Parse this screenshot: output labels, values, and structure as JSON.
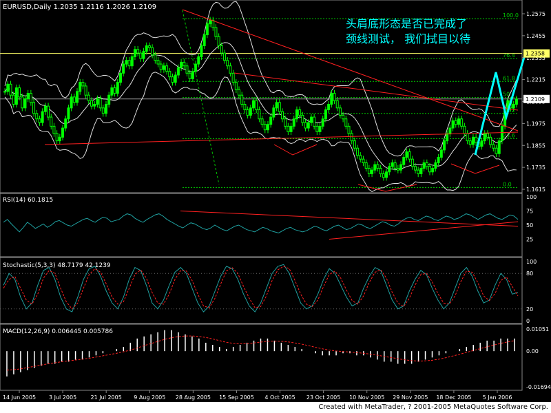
{
  "chart_data": [
    {
      "type": "candlestick",
      "title": "EURUSD,Daily",
      "ohlc_label": "1.2035 1.2116 1.2026 1.2109",
      "ylim": [
        1.1615,
        1.2575
      ],
      "y_ticks": [
        1.2575,
        1.2455,
        1.2335,
        1.2215,
        1.2095,
        1.1975,
        1.1855,
        1.1735,
        1.1615
      ],
      "current_price_label": "1.2109",
      "highlight_level": 1.2358,
      "highlight_level_label": "1.2358",
      "fib_levels": [
        {
          "label": "100.0",
          "value": 1.2548
        },
        {
          "label": "76.4",
          "value": 1.233
        },
        {
          "label": "61.8",
          "value": 1.2205
        },
        {
          "label": "50",
          "value": 1.2117
        },
        {
          "label": "38.2",
          "value": 1.203
        },
        {
          "label": "23.6",
          "value": 1.1892
        },
        {
          "label": "0.0",
          "value": 1.1625
        }
      ],
      "annotation": [
        "头肩底形态是否已完成了",
        "颈线测试， 我们拭目以待"
      ],
      "close_series": [
        1.215,
        1.219,
        1.213,
        1.208,
        1.217,
        1.212,
        1.206,
        1.211,
        1.214,
        1.209,
        1.203,
        1.2,
        1.198,
        1.204,
        1.207,
        1.201,
        1.196,
        1.192,
        1.188,
        1.19,
        1.195,
        1.2,
        1.206,
        1.212,
        1.209,
        1.215,
        1.22,
        1.218,
        1.213,
        1.21,
        1.207,
        1.208,
        1.211,
        1.206,
        1.203,
        1.208,
        1.213,
        1.217,
        1.214,
        1.22,
        1.225,
        1.23,
        1.232,
        1.229,
        1.234,
        1.238,
        1.236,
        1.233,
        1.237,
        1.24,
        1.239,
        1.235,
        1.232,
        1.23,
        1.227,
        1.229,
        1.226,
        1.223,
        1.22,
        1.224,
        1.228,
        1.231,
        1.229,
        1.225,
        1.222,
        1.226,
        1.23,
        1.234,
        1.24,
        1.246,
        1.252,
        1.254,
        1.25,
        1.245,
        1.24,
        1.236,
        1.232,
        1.229,
        1.225,
        1.22,
        1.216,
        1.213,
        1.208,
        1.205,
        1.202,
        1.206,
        1.21,
        1.205,
        1.2,
        1.197,
        1.194,
        1.197,
        1.201,
        1.206,
        1.209,
        1.204,
        1.2,
        1.196,
        1.193,
        1.196,
        1.2,
        1.205,
        1.202,
        1.198,
        1.195,
        1.198,
        1.201,
        1.196,
        1.193,
        1.196,
        1.2,
        1.205,
        1.208,
        1.214,
        1.21,
        1.206,
        1.202,
        1.2,
        1.196,
        1.192,
        1.188,
        1.184,
        1.18,
        1.178,
        1.176,
        1.173,
        1.17,
        1.172,
        1.175,
        1.173,
        1.17,
        1.168,
        1.171,
        1.174,
        1.176,
        1.173,
        1.172,
        1.175,
        1.179,
        1.182,
        1.178,
        1.174,
        1.172,
        1.17,
        1.173,
        1.176,
        1.174,
        1.171,
        1.173,
        1.176,
        1.179,
        1.183,
        1.188,
        1.192,
        1.195,
        1.199,
        1.197,
        1.2,
        1.196,
        1.192,
        1.188,
        1.186,
        1.19,
        1.187,
        1.185,
        1.188,
        1.192,
        1.19,
        1.186,
        1.184,
        1.181,
        1.188,
        1.196,
        1.204,
        1.21,
        1.206,
        1.208,
        1.2109
      ]
    },
    {
      "type": "line",
      "title": "RSI(14) 60.1815",
      "ylim": [
        0,
        100
      ],
      "y_ticks": [
        100,
        75,
        50,
        25
      ],
      "values": [
        55,
        60,
        52,
        45,
        38,
        46,
        55,
        50,
        44,
        48,
        52,
        46,
        50,
        56,
        58,
        54,
        50,
        48,
        52,
        56,
        60,
        62,
        58,
        55,
        60,
        64,
        62,
        56,
        58,
        60,
        66,
        70,
        68,
        62,
        58,
        55,
        60,
        64,
        68,
        70,
        66,
        60,
        56,
        52,
        48,
        45,
        50,
        54,
        52,
        48,
        44,
        42,
        45,
        50,
        46,
        42,
        40,
        44,
        48,
        50,
        46,
        42,
        40,
        38,
        42,
        46,
        44,
        40,
        38,
        36,
        40,
        44,
        46,
        42,
        40,
        38,
        40,
        44,
        48,
        46,
        42,
        40,
        44,
        48,
        50,
        46,
        42,
        44,
        48,
        52,
        50,
        46,
        44,
        48,
        52,
        56,
        54,
        50,
        48,
        52,
        58,
        62,
        64,
        60,
        58,
        62,
        66,
        64,
        60,
        58,
        62,
        66,
        64,
        60,
        62,
        66,
        70,
        68,
        64,
        60,
        64,
        68,
        70,
        66,
        62,
        60,
        64,
        68,
        66,
        60
      ]
    },
    {
      "type": "line",
      "title": "Stochastic(5,3,3) 48.7179 42.1239",
      "ylim": [
        0,
        100
      ],
      "y_ticks": [
        100,
        80,
        20,
        0
      ],
      "series": [
        {
          "values": [
            60,
            80,
            70,
            40,
            20,
            30,
            60,
            85,
            90,
            70,
            40,
            20,
            15,
            40,
            70,
            88,
            92,
            75,
            50,
            30,
            20,
            40,
            70,
            90,
            85,
            60,
            30,
            20,
            35,
            60,
            82,
            90,
            80,
            55,
            30,
            15,
            25,
            50,
            75,
            92,
            88,
            70,
            45,
            25,
            15,
            30,
            55,
            80,
            92,
            95,
            80,
            55,
            30,
            20,
            25,
            45,
            70,
            88,
            80,
            60,
            40,
            25,
            30,
            55,
            75,
            90,
            85,
            60,
            35,
            20,
            25,
            50,
            70,
            85,
            78,
            55,
            35,
            20,
            30,
            55,
            80,
            90,
            75,
            50,
            30,
            35,
            60,
            80,
            70,
            45,
            48
          ]
        },
        {
          "values": [
            55,
            70,
            75,
            55,
            35,
            28,
            45,
            72,
            85,
            80,
            55,
            32,
            20,
            30,
            55,
            78,
            88,
            82,
            62,
            40,
            28,
            32,
            55,
            78,
            86,
            72,
            48,
            30,
            28,
            45,
            70,
            85,
            84,
            68,
            45,
            25,
            22,
            38,
            62,
            84,
            90,
            80,
            58,
            38,
            22,
            24,
            42,
            68,
            86,
            92,
            88,
            68,
            45,
            28,
            24,
            35,
            58,
            78,
            84,
            72,
            52,
            34,
            28,
            42,
            65,
            82,
            86,
            72,
            48,
            30,
            24,
            38,
            60,
            78,
            80,
            66,
            46,
            30,
            28,
            42,
            66,
            84,
            82,
            64,
            42,
            34,
            46,
            68,
            74,
            58,
            42
          ]
        }
      ]
    },
    {
      "type": "bar",
      "title": "MACD(12,26,9) 0.006445 0.005786",
      "y_ticks": [
        0.01051,
        0.0,
        -0.01694
      ],
      "ylim": [
        -0.01694,
        0.01051
      ],
      "values": [
        -0.012,
        -0.011,
        -0.01,
        -0.009,
        -0.008,
        -0.007,
        -0.006,
        -0.006,
        -0.005,
        -0.005,
        -0.004,
        -0.004,
        -0.003,
        -0.002,
        -0.001,
        0.0,
        0.001,
        0.002,
        0.004,
        0.006,
        0.007,
        0.008,
        0.009,
        0.01,
        0.01,
        0.009,
        0.008,
        0.007,
        0.006,
        0.004,
        0.003,
        0.002,
        0.001,
        0.002,
        0.003,
        0.004,
        0.005,
        0.006,
        0.006,
        0.005,
        0.004,
        0.003,
        0.002,
        0.001,
        0.0,
        -0.001,
        -0.002,
        -0.002,
        -0.002,
        -0.001,
        -0.001,
        -0.002,
        -0.002,
        -0.003,
        -0.004,
        -0.005,
        -0.005,
        -0.006,
        -0.006,
        -0.006,
        -0.005,
        -0.004,
        -0.003,
        -0.002,
        -0.001,
        0.0,
        0.001,
        0.002,
        0.003,
        0.004,
        0.005,
        0.005,
        0.006,
        0.006,
        0.006
      ],
      "signal": [
        -0.009,
        -0.0088,
        -0.0084,
        -0.0078,
        -0.0072,
        -0.0066,
        -0.006,
        -0.0055,
        -0.005,
        -0.0046,
        -0.0042,
        -0.0038,
        -0.0034,
        -0.0028,
        -0.0022,
        -0.0016,
        -0.001,
        -0.0003,
        0.0005,
        0.0015,
        0.0026,
        0.0036,
        0.0046,
        0.0056,
        0.0064,
        0.0069,
        0.0072,
        0.0072,
        0.007,
        0.0065,
        0.0058,
        0.005,
        0.0042,
        0.0037,
        0.0035,
        0.0036,
        0.0039,
        0.0043,
        0.0047,
        0.0048,
        0.0047,
        0.0044,
        0.0039,
        0.0033,
        0.0026,
        0.0018,
        0.0011,
        0.0005,
        0.0001,
        -0.0002,
        -0.0004,
        -0.0007,
        -0.001,
        -0.0014,
        -0.0019,
        -0.0025,
        -0.003,
        -0.0036,
        -0.0041,
        -0.0045,
        -0.0047,
        -0.0046,
        -0.0043,
        -0.0038,
        -0.0031,
        -0.0023,
        -0.0015,
        -0.0006,
        0.0003,
        0.0012,
        0.0021,
        0.0029,
        0.0037,
        0.0044,
        0.005
      ]
    }
  ],
  "x_labels": [
    "14 Jun 2005",
    "3 Jul 2005",
    "21 Jul 2005",
    "9 Aug 2005",
    "28 Aug 2005",
    "15 Sep 2005",
    "4 Oct 2005",
    "23 Oct 2005",
    "10 Nov 2005",
    "29 Nov 2005",
    "18 Dec 2005",
    "5 Jan 2006"
  ],
  "footer": "Created with MetaTrader, ? 2001-2005 MetaQuotes Software Corp.",
  "colors": {
    "background": "#000000",
    "bull_candle": "#00ff00",
    "bear_candle": "#000000",
    "trendline": "#ff2020",
    "fib": "#00cc00",
    "annotation": "#00ffff",
    "rsi": "#1fa0a0",
    "stoch_main": "#1fa0a0",
    "stoch_signal": "#ff2020",
    "macd_bar": "#ffffff",
    "macd_signal": "#ff2020",
    "highlight_level": "#ffff66"
  }
}
